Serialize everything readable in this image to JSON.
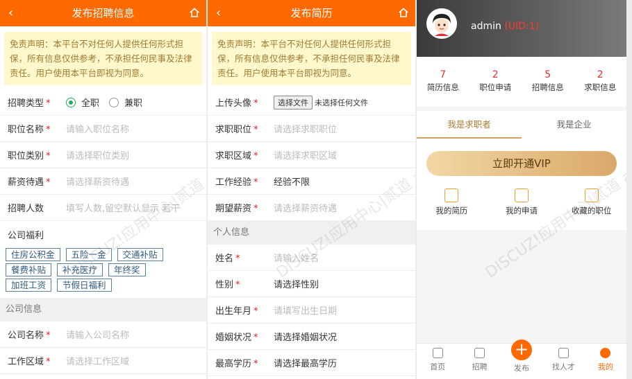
{
  "p1": {
    "title": "发布招聘信息",
    "disclaimer": "免责声明：本平台不对任何人提供任何形式担保，所有信息仅供参考，不承担任何民事及法律责任。用户使用本平台即视为同意。",
    "type_label": "招聘类型",
    "type_options": [
      "全职",
      "兼职"
    ],
    "fields": [
      {
        "label": "职位名称",
        "placeholder": "请输入职位名称"
      },
      {
        "label": "职位类别",
        "placeholder": "请选择职位类别"
      },
      {
        "label": "薪资待遇",
        "placeholder": "请选择薪资待遇"
      },
      {
        "label": "招聘人数",
        "placeholder": "填写人数,留空默认显示 若干"
      }
    ],
    "welfare_label": "公司福利",
    "tags": [
      "住房公积金",
      "五险一金",
      "交通补贴",
      "餐费补贴",
      "补充医疗",
      "年终奖",
      "加班工资",
      "节假日福利"
    ],
    "section": "公司信息",
    "company_label": "公司名称",
    "company_placeholder": "请输入公司名称",
    "area_label": "工作区域",
    "area_placeholder": "请选择工作区域"
  },
  "p2": {
    "title": "发布简历",
    "disclaimer": "免责声明：本平台不对任何人提供任何形式担保，所有信息仅供参考，不承担任何民事及法律责任。用户使用本平台即视为同意。",
    "avatar_label": "上传头像",
    "file_button": "选择文件",
    "file_status": "未选择任何文件",
    "fields": [
      {
        "label": "求职职位",
        "placeholder": "请选择求职职位"
      },
      {
        "label": "求职区域",
        "placeholder": "请选择求职区域"
      }
    ],
    "exp_label": "工作经验",
    "exp_value": "经验不限",
    "salary_label": "期望薪资",
    "salary_placeholder": "请选择薪资待遇",
    "section": "个人信息",
    "name_label": "姓名",
    "name_placeholder": "请输入姓名",
    "gender_label": "性别",
    "gender_value": "请选择性别",
    "birth_label": "出生年月",
    "birth_placeholder": "请填写出生日期",
    "marital_label": "婚姻状况",
    "marital_value": "请选择婚姻状况",
    "edu_label": "最高学历",
    "edu_value": "请选择最高学历"
  },
  "p3": {
    "username": "admin",
    "uid": "(UID:1)",
    "stats": [
      {
        "n": "7",
        "t": "简历信息"
      },
      {
        "n": "2",
        "t": "职位申请"
      },
      {
        "n": "5",
        "t": "招聘信息"
      },
      {
        "n": "2",
        "t": "求职信息"
      }
    ],
    "tabs": [
      "我是求职者",
      "我是企业"
    ],
    "vip": "立即开通VIP",
    "quick": [
      "我的简历",
      "我的申请",
      "收藏的职位"
    ],
    "tabbar": [
      "首页",
      "招聘",
      "发布",
      "找人才",
      "我的"
    ]
  },
  "watermark": "DISCUZ!应用中心|贰道 addon.dismall.com",
  "accent": "#ff6a00"
}
